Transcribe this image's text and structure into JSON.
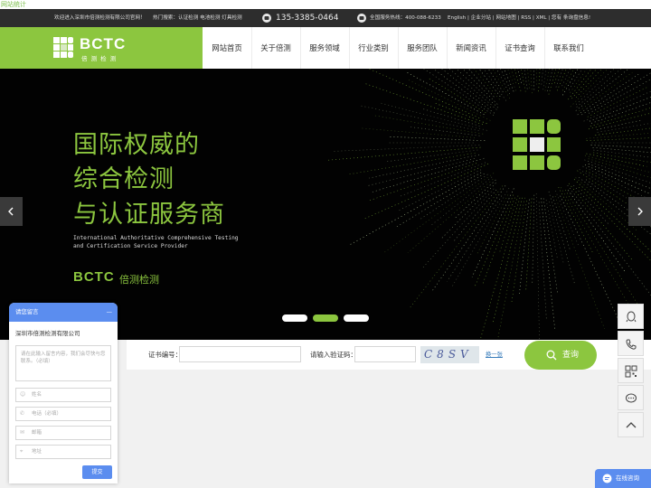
{
  "stat_link": "网站统计",
  "topbar": {
    "welcome": "欢迎进入深圳市倍测检测有限公司官网！",
    "hot_search": "热门搜索：认证检测 电池检测 灯具检测",
    "phone": "135-3385-0464",
    "hotline": "全国服务热线：400-088-6233",
    "links": "English | 企业分站 | 网站地图 | RSS | XML | 您有  条询盘信息!"
  },
  "logo": {
    "text": "BCTC",
    "sub": "倍 测 检 测"
  },
  "nav": {
    "items": [
      "网站首页",
      "关于倍测",
      "服务领域",
      "行业类别",
      "服务团队",
      "新闻资讯",
      "证书查询",
      "联系我们"
    ]
  },
  "banner": {
    "line1": "国际权威的",
    "line2": "综合检测",
    "line3": "与认证服务商",
    "en1": "International Authoritative Comprehensive Testing",
    "en2": "and Certification Service Provider",
    "brand": "BCTC",
    "brand_cn": "倍测检测",
    "slides": 3,
    "active_slide": 2
  },
  "cert": {
    "number_label": "证书编号：",
    "code_label": "请输入验证码：",
    "captcha_text": "C8SV",
    "refresh": "换一张",
    "query": "查询"
  },
  "message": {
    "header": "请您留言",
    "minimize": "—",
    "company": "深圳市倍测检测有限公司",
    "content_placeholder": "请在此输入留言内容，我们会尽快与您联系。（必填）",
    "name_placeholder": "姓名",
    "phone_placeholder": "电话（必填）",
    "email_placeholder": "邮箱",
    "address_placeholder": "地址",
    "submit": "提交"
  },
  "online": "在线咨询",
  "colors": {
    "brand_green": "#8cc63f",
    "chat_blue": "#5b8def",
    "topbar": "#2d2d2d"
  }
}
